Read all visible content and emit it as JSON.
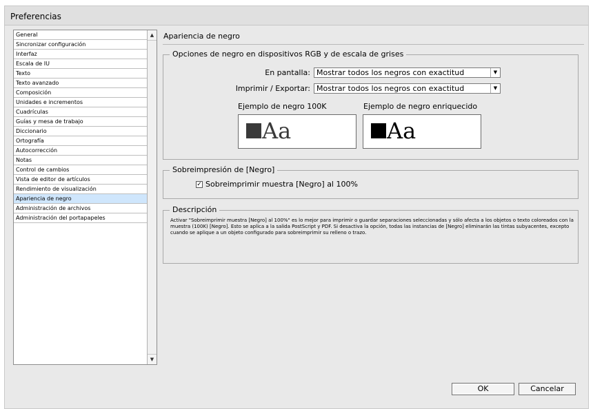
{
  "window": {
    "title": "Preferencias"
  },
  "sidebar": {
    "items": [
      {
        "label": "General"
      },
      {
        "label": "Sincronizar configuración"
      },
      {
        "label": "Interfaz"
      },
      {
        "label": "Escala de IU"
      },
      {
        "label": "Texto"
      },
      {
        "label": "Texto avanzado"
      },
      {
        "label": "Composición"
      },
      {
        "label": "Unidades e incrementos"
      },
      {
        "label": "Cuadrículas"
      },
      {
        "label": "Guías y mesa de trabajo"
      },
      {
        "label": "Diccionario"
      },
      {
        "label": "Ortografía"
      },
      {
        "label": "Autocorrección"
      },
      {
        "label": "Notas"
      },
      {
        "label": "Control de cambios"
      },
      {
        "label": "Vista de editor de artículos"
      },
      {
        "label": "Rendimiento de visualización"
      },
      {
        "label": "Apariencia de negro"
      },
      {
        "label": "Administración de archivos"
      },
      {
        "label": "Administración del portapapeles"
      }
    ],
    "selected_index": 17
  },
  "panel": {
    "title": "Apariencia de negro",
    "options_group": {
      "legend": "Opciones de negro en dispositivos RGB y de escala de grises",
      "on_screen": {
        "label": "En pantalla:",
        "value": "Mostrar todos los negros con exactitud"
      },
      "print_export": {
        "label": "Imprimir / Exportar:",
        "value": "Mostrar todos los negros con exactitud"
      },
      "sample_100k": {
        "label": "Ejemplo de negro 100K",
        "text": "Aa",
        "swatch_color": "#3a3a3a"
      },
      "sample_rich": {
        "label": "Ejemplo de negro enriquecido",
        "text": "Aa",
        "swatch_color": "#000000"
      }
    },
    "overprint_group": {
      "legend": "Sobreimpresión de [Negro]",
      "checkbox": {
        "label": "Sobreimprimir muestra [Negro] al 100%",
        "checked": true,
        "check_mark": "✓"
      }
    },
    "description_group": {
      "legend": "Descripción",
      "text": "Activar \"Sobreimprimir muestra [Negro] al 100%\" es lo mejor para imprimir o guardar separaciones seleccionadas y sólo afecta a los objetos o texto coloreados con la muestra (100K) [Negro]. Esto se aplica a la salida PostScript y PDF. Si desactiva la opción, todas las instancias de [Negro] eliminarán las tintas subyacentes, excepto cuando se aplique a un objeto configurado para sobreimprimir su relleno o trazo."
    }
  },
  "buttons": {
    "ok": "OK",
    "cancel": "Cancelar"
  },
  "colors": {
    "selected_item": "#cfe6fc",
    "dialog_bg": "#e9e9e9"
  }
}
